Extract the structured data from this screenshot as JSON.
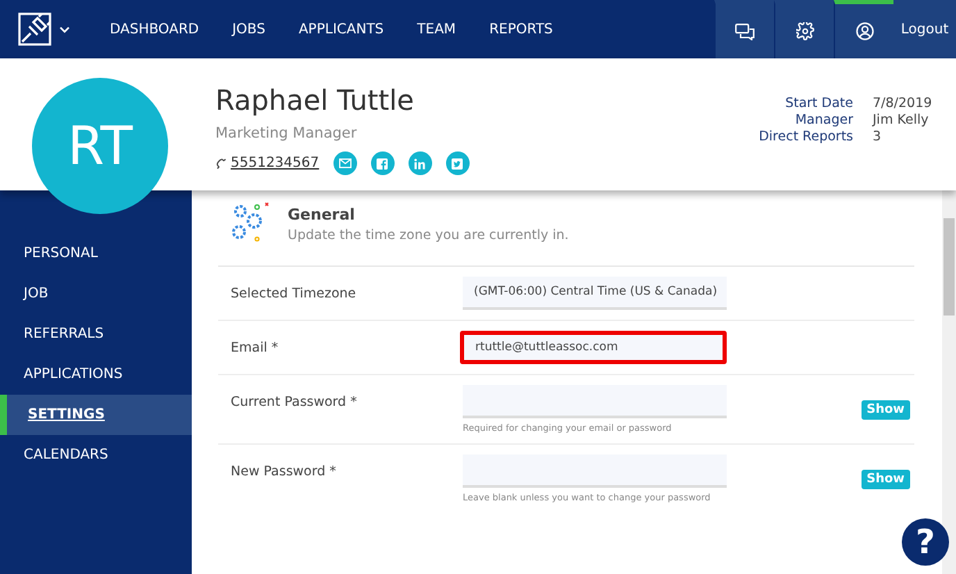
{
  "nav": {
    "items": [
      {
        "label": "DASHBOARD",
        "selected": false
      },
      {
        "label": "JOBS",
        "selected": false
      },
      {
        "label": "APPLICANTS",
        "selected": false
      },
      {
        "label": "TEAM",
        "selected": false
      },
      {
        "label": "REPORTS",
        "selected": false
      }
    ],
    "tools": [
      {
        "kind": "chat",
        "selected": false
      },
      {
        "kind": "settings",
        "selected": false
      },
      {
        "kind": "profile",
        "selected": true
      }
    ],
    "logout": "Logout"
  },
  "profile": {
    "initials": "RT",
    "name": "Raphael Tuttle",
    "title": "Marketing Manager",
    "phone": "5551234567",
    "socials": [
      {
        "kind": "email"
      },
      {
        "kind": "facebook"
      },
      {
        "kind": "linkedin"
      },
      {
        "kind": "twitter"
      }
    ],
    "details": [
      {
        "label": "Start Date",
        "value": "7/8/2019"
      },
      {
        "label": "Manager",
        "value": "Jim Kelly"
      },
      {
        "label": "Direct Reports",
        "value": "3"
      }
    ]
  },
  "sidebar": {
    "items": [
      {
        "label": "PERSONAL",
        "selected": false
      },
      {
        "label": "JOB",
        "selected": false
      },
      {
        "label": "REFERRALS",
        "selected": false
      },
      {
        "label": "APPLICATIONS",
        "selected": false
      },
      {
        "label": "SETTINGS",
        "selected": true
      },
      {
        "label": "CALENDARS",
        "selected": false
      }
    ]
  },
  "section": {
    "title": "General",
    "subtitle": "Update the time zone you are currently in.",
    "fields": [
      {
        "kind": "select",
        "label": "Selected Timezone",
        "value": "(GMT-06:00) Central Time (US & Canada)",
        "highlighted": false
      },
      {
        "kind": "text",
        "label": "Email *",
        "value": "rtuttle@tuttleassoc.com",
        "highlighted": true
      },
      {
        "kind": "password",
        "label": "Current Password *",
        "help": "Required for changing your email or password",
        "button": "Show",
        "highlighted": false
      },
      {
        "kind": "password",
        "label": "New Password *",
        "help": "Leave blank unless you want to change your password",
        "button": "Show",
        "highlighted": false
      }
    ]
  },
  "help_button": "?"
}
